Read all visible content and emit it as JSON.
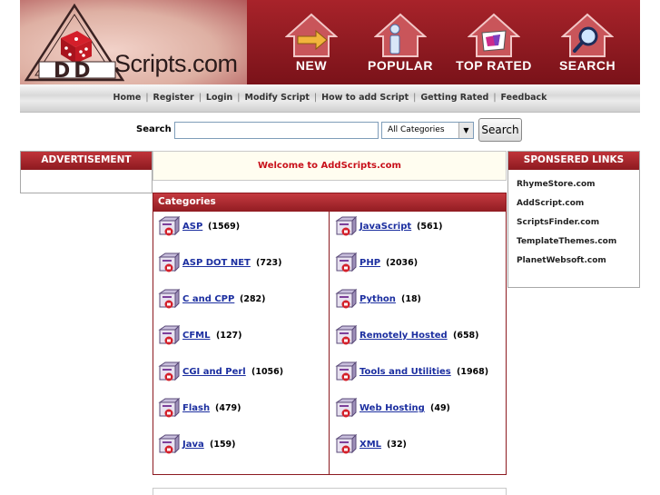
{
  "logo": {
    "letters": "DD",
    "text": "Scripts.com"
  },
  "header_nav": [
    {
      "label": "NEW",
      "icon": "new-arrow-icon"
    },
    {
      "label": "POPULAR",
      "icon": "info-icon"
    },
    {
      "label": "TOP RATED",
      "icon": "rating-bar-icon"
    },
    {
      "label": "SEARCH",
      "icon": "magnifier-icon"
    }
  ],
  "menu": [
    "Home",
    "Register",
    "Login",
    "Modify Script",
    "How to add Script",
    "Getting Rated",
    "Feedback"
  ],
  "search": {
    "label": "Search :",
    "value": "",
    "category": "All Categories",
    "button": "Search"
  },
  "advertisement": {
    "title": "ADVERTISEMENT"
  },
  "welcome": "Welcome to AddScripts.com",
  "categories": {
    "title": "Categories",
    "left": [
      {
        "name": "ASP",
        "count": "(1569)"
      },
      {
        "name": "ASP DOT NET",
        "count": "(723)"
      },
      {
        "name": "C and CPP",
        "count": "(282)"
      },
      {
        "name": "CFML",
        "count": "(127)"
      },
      {
        "name": "CGI and Perl",
        "count": "(1056)"
      },
      {
        "name": "Flash",
        "count": "(479)"
      },
      {
        "name": "Java",
        "count": "(159)"
      }
    ],
    "right": [
      {
        "name": "JavaScript",
        "count": "(561)"
      },
      {
        "name": "PHP",
        "count": "(2036)"
      },
      {
        "name": "Python",
        "count": "(18)"
      },
      {
        "name": "Remotely Hosted",
        "count": "(658)"
      },
      {
        "name": "Tools and Utilities",
        "count": "(1968)"
      },
      {
        "name": "Web Hosting",
        "count": "(49)"
      },
      {
        "name": "XML",
        "count": "(32)"
      }
    ]
  },
  "sponsored": {
    "title": "SPONSERED LINKS",
    "links": [
      "RhymeStore.com",
      "AddScript.com",
      "ScriptsFinder.com",
      "TemplateThemes.com",
      "PlanetWebsoft.com"
    ]
  },
  "colors": {
    "header_red": "#8e1a21",
    "link_blue": "#1c2fa0",
    "welcome_red": "#c8101a"
  }
}
